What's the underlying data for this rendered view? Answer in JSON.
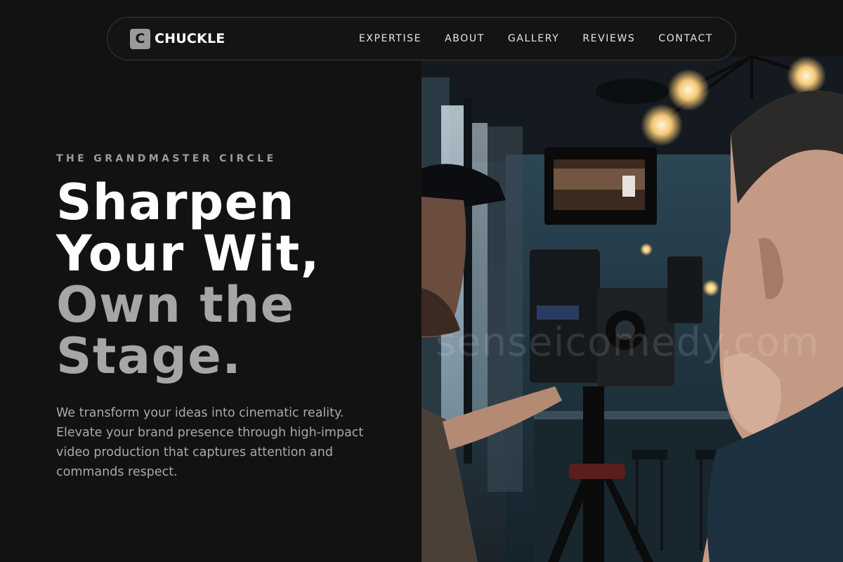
{
  "brand": {
    "mark": "C",
    "name": "CHUCKLE"
  },
  "nav": {
    "links": [
      "EXPERTISE",
      "ABOUT",
      "GALLERY",
      "REVIEWS",
      "CONTACT"
    ]
  },
  "hero": {
    "eyebrow": "THE GRANDMASTER CIRCLE",
    "headline": [
      "Sharpen",
      "Your Wit,",
      "Own the",
      "Stage."
    ],
    "lead": "We transform your ideas into cinematic reality. Elevate your brand presence through high-impact video production that captures attention and commands respect.",
    "image_watermark": "senseicomedy.com"
  },
  "colors": {
    "background": "#121212",
    "headline_primary": "#ffffff",
    "headline_secondary": "#a6a6a6",
    "body_text": "#a9a9a9"
  }
}
